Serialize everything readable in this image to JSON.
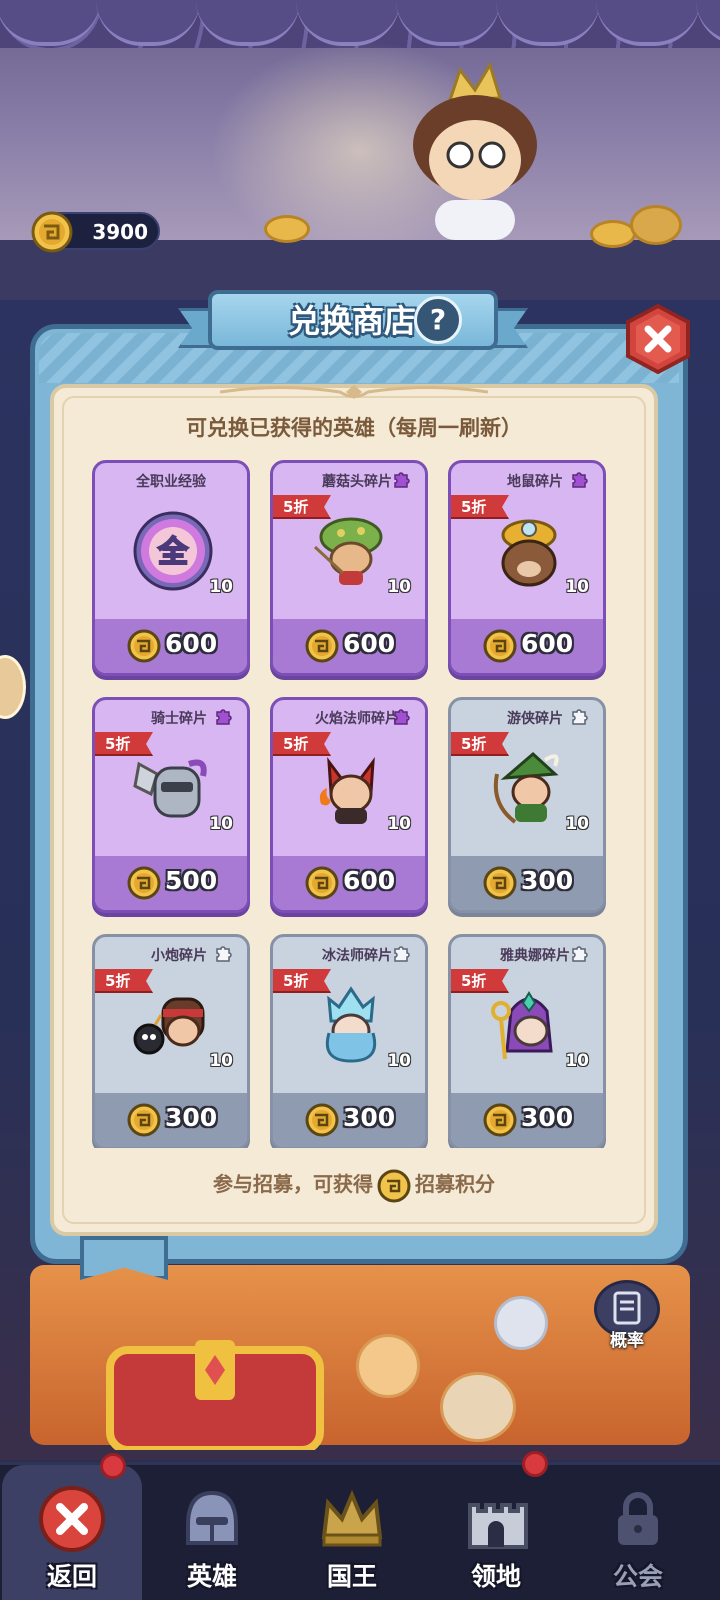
{
  "currency": {
    "amount": "3900",
    "icon": "coin-icon"
  },
  "shop": {
    "title": "兑换商店",
    "help_label": "?",
    "subtitle": "可兑换已获得的英雄（每周一刷新）",
    "footer": {
      "before": "参与招募，可获得",
      "after": "招募积分"
    },
    "items": [
      {
        "name": "全职业经验",
        "discount": "",
        "qty": "10",
        "price": "600",
        "rarity": "purple",
        "icon": "all-class-exp-icon",
        "orb_label": "全"
      },
      {
        "name": "蘑菇头碎片",
        "discount": "5折",
        "qty": "10",
        "price": "600",
        "rarity": "purple",
        "icon": "mushroom-hero-icon"
      },
      {
        "name": "地鼠碎片",
        "discount": "5折",
        "qty": "10",
        "price": "600",
        "rarity": "purple",
        "icon": "mole-hero-icon"
      },
      {
        "name": "骑士碎片",
        "discount": "5折",
        "qty": "10",
        "price": "500",
        "rarity": "purple",
        "icon": "knight-hero-icon"
      },
      {
        "name": "火焰法师碎片",
        "discount": "5折",
        "qty": "10",
        "price": "600",
        "rarity": "purple",
        "icon": "fire-mage-hero-icon"
      },
      {
        "name": "游侠碎片",
        "discount": "5折",
        "qty": "10",
        "price": "300",
        "rarity": "grey",
        "icon": "ranger-hero-icon"
      },
      {
        "name": "小炮碎片",
        "discount": "5折",
        "qty": "10",
        "price": "300",
        "rarity": "grey",
        "icon": "cannon-hero-icon"
      },
      {
        "name": "冰法师碎片",
        "discount": "5折",
        "qty": "10",
        "price": "300",
        "rarity": "grey",
        "icon": "ice-mage-hero-icon"
      },
      {
        "name": "雅典娜碎片",
        "discount": "5折",
        "qty": "10",
        "price": "300",
        "rarity": "grey",
        "icon": "athena-hero-icon"
      }
    ]
  },
  "probability_label": "概率",
  "nav": [
    {
      "label": "返回",
      "icon": "close-icon",
      "active": true,
      "badge": true
    },
    {
      "label": "英雄",
      "icon": "helmet-icon",
      "active": false,
      "badge": false
    },
    {
      "label": "国王",
      "icon": "crown-icon",
      "active": false,
      "badge": false
    },
    {
      "label": "领地",
      "icon": "castle-icon",
      "active": false,
      "badge": true
    },
    {
      "label": "公会",
      "icon": "lock-icon",
      "active": false,
      "badge": false
    }
  ],
  "colors": {
    "discount": "#d03a3a",
    "purple_card": "#d8b6f2",
    "grey_card": "#c9d3df",
    "panel_blue": "#7fb6d6"
  }
}
